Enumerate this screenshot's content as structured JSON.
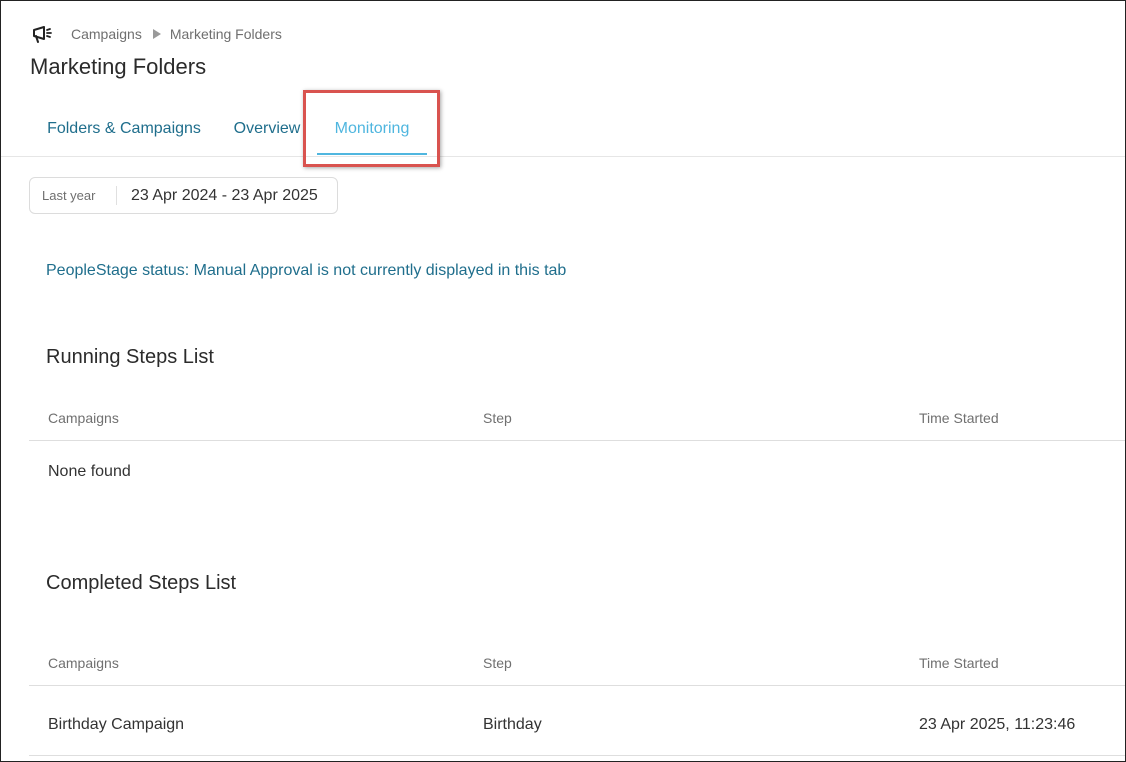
{
  "breadcrumb": {
    "icon": "megaphone-icon",
    "items": [
      "Campaigns",
      "Marketing Folders"
    ]
  },
  "page_title": "Marketing Folders",
  "tabs": [
    {
      "label": "Folders & Campaigns",
      "active": false
    },
    {
      "label": "Overview",
      "active": false
    },
    {
      "label": "Monitoring",
      "active": true
    }
  ],
  "date_filter": {
    "preset": "Last year",
    "range": "23 Apr 2024 - 23 Apr 2025"
  },
  "status_note": "PeopleStage status: Manual Approval is not currently displayed in this tab",
  "running": {
    "title": "Running Steps List",
    "columns": [
      "Campaigns",
      "Step",
      "Time Started"
    ],
    "empty_text": "None found"
  },
  "completed": {
    "title": "Completed Steps List",
    "columns": [
      "Campaigns",
      "Step",
      "Time Started"
    ],
    "rows": [
      {
        "campaign": "Birthday Campaign",
        "step": "Birthday",
        "time_started": "23 Apr 2025, 11:23:46"
      }
    ]
  },
  "colors": {
    "tab_text": "#1f6e8c",
    "active_tab": "#4fb6df",
    "highlight": "#d9534f"
  }
}
